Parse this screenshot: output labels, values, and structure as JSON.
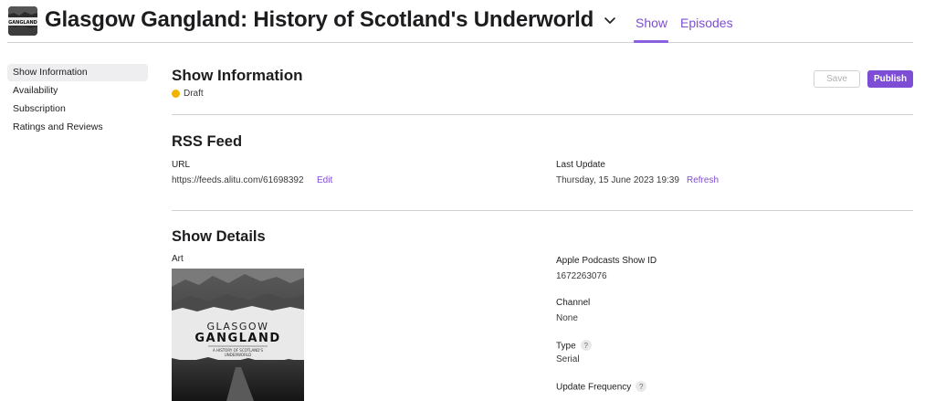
{
  "header": {
    "show_title": "Glasgow Gangland: History of Scotland's Underworld",
    "tabs": [
      {
        "label": "Show",
        "active": true
      },
      {
        "label": "Episodes",
        "active": false
      }
    ],
    "thumbnail_text": "GANGLAND"
  },
  "sidebar": {
    "items": [
      {
        "label": "Show Information",
        "active": true
      },
      {
        "label": "Availability",
        "active": false
      },
      {
        "label": "Subscription",
        "active": false
      },
      {
        "label": "Ratings and Reviews",
        "active": false
      }
    ]
  },
  "main": {
    "title": "Show Information",
    "status": {
      "label": "Draft",
      "color": "#f0b400"
    },
    "buttons": {
      "save": "Save",
      "publish": "Publish"
    },
    "rss": {
      "title": "RSS Feed",
      "url_label": "URL",
      "url_value": "https://feeds.alitu.com/61698392",
      "edit_link": "Edit",
      "last_update_label": "Last Update",
      "last_update_value": "Thursday, 15 June 2023 19:39",
      "refresh_link": "Refresh"
    },
    "details": {
      "title": "Show Details",
      "art_label": "Art",
      "artwork": {
        "line1": "GLASGOW",
        "line2": "GANGLAND",
        "line3": "A HISTORY OF SCOTLAND'S",
        "line4": "UNDERWORLD"
      },
      "show_id_label": "Apple Podcasts Show ID",
      "show_id_value": "1672263076",
      "channel_label": "Channel",
      "channel_value": "None",
      "type_label": "Type",
      "type_value": "Serial",
      "frequency_label": "Update Frequency",
      "help_glyph": "?"
    }
  },
  "colors": {
    "accent": "#7d4dd6",
    "divider": "#d2d2d7",
    "sidebar_active": "#eeeef0"
  }
}
